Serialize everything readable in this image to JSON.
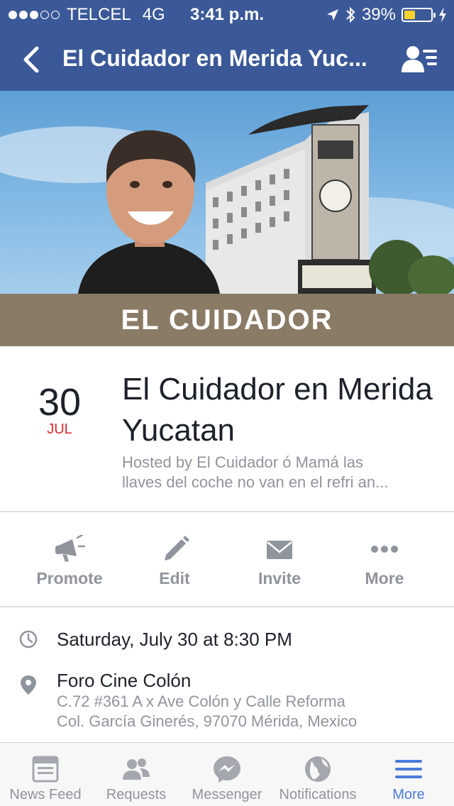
{
  "status_bar": {
    "carrier": "TELCEL",
    "network": "4G",
    "time": "3:41 p.m.",
    "battery": "39%",
    "battery_level": 0.39,
    "signal_bars": 3,
    "signal_total": 5
  },
  "nav": {
    "title": "El Cuidador en Merida Yuc...",
    "back_icon": "chevron-left-icon",
    "right_icon": "profile-list-icon"
  },
  "cover": {
    "band_text": "EL CUIDADOR"
  },
  "event": {
    "day": "30",
    "month": "JUL",
    "title": "El Cuidador en Merida Yucatan",
    "host_line1": "Hosted by El Cuidador ó Mamá las",
    "host_line2": "llaves del coche no van en el refri an..."
  },
  "actions": [
    {
      "label": "Promote",
      "icon": "megaphone-icon"
    },
    {
      "label": "Edit",
      "icon": "pencil-icon"
    },
    {
      "label": "Invite",
      "icon": "envelope-icon"
    },
    {
      "label": "More",
      "icon": "more-dots-icon"
    }
  ],
  "details": {
    "when": "Saturday, July 30 at 8:30 PM",
    "place": "Foro Cine Colón",
    "address_line1": "C.72 #361 A x Ave Colón y Calle Reforma",
    "address_line2": "Col. García Ginerés, 97070 Mérida, Mexico"
  },
  "tabbar": [
    {
      "label": "News Feed",
      "icon": "news-feed-icon",
      "active": false
    },
    {
      "label": "Requests",
      "icon": "friend-requests-icon",
      "active": false
    },
    {
      "label": "Messenger",
      "icon": "messenger-icon",
      "active": false
    },
    {
      "label": "Notifications",
      "icon": "globe-icon",
      "active": false
    },
    {
      "label": "More",
      "icon": "hamburger-menu-icon",
      "active": true
    }
  ],
  "colors": {
    "brand_blue": "#3b5998",
    "date_red": "#e0262d",
    "muted_gray": "#90949c",
    "active_tab": "#4b7bd8",
    "cover_band": "#8a7b66"
  }
}
